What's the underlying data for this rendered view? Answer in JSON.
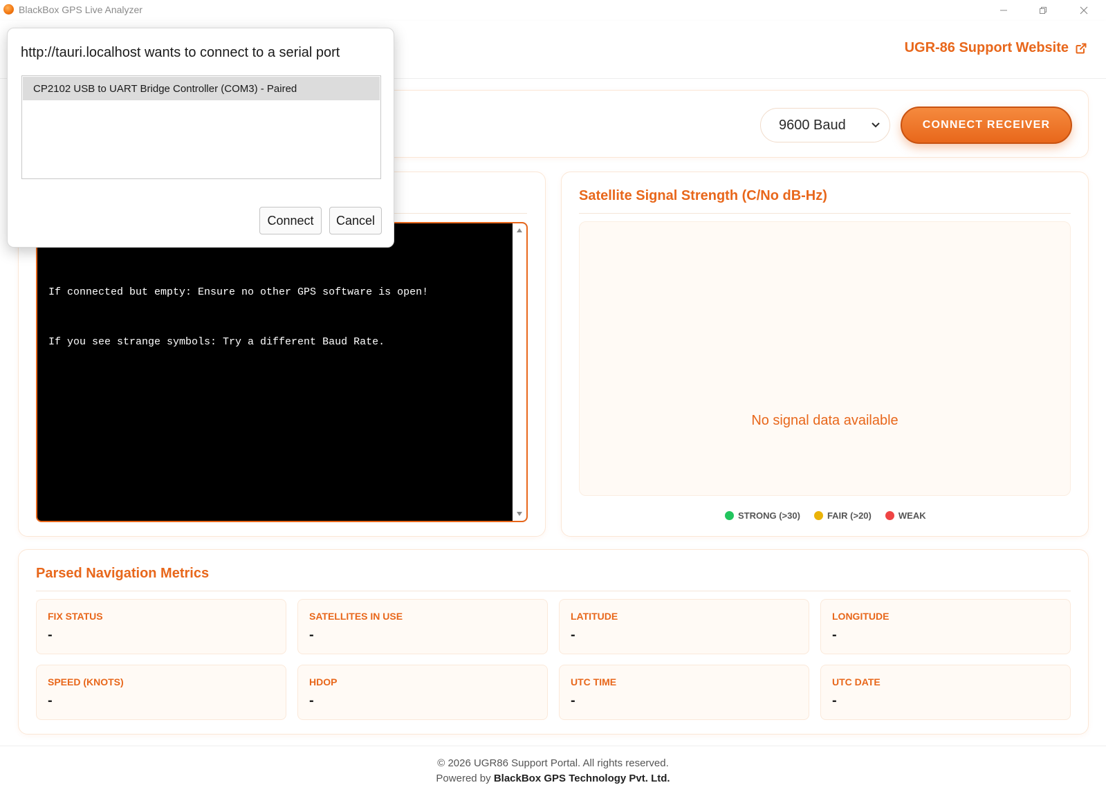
{
  "window": {
    "title": "BlackBox GPS Live Analyzer",
    "controls": [
      "minimize",
      "restore",
      "close"
    ]
  },
  "header": {
    "support_link": "UGR-86 Support Website",
    "support_icon": "external-link-icon"
  },
  "controls": {
    "baud_value": "9600 Baud",
    "connect_button": "CONNECT RECEIVER"
  },
  "terminal": {
    "lines": [
      "If connected but empty: Ensure no other GPS software is open!",
      "If you see strange symbols: Try a different Baud Rate."
    ]
  },
  "signal": {
    "title": "Satellite Signal Strength (C/No dB-Hz)",
    "empty_message": "No signal data available",
    "legend": [
      {
        "label": "STRONG (>30)",
        "color": "#22c55e"
      },
      {
        "label": "FAIR (>20)",
        "color": "#eab308"
      },
      {
        "label": "WEAK",
        "color": "#ef4444"
      }
    ]
  },
  "metrics": {
    "title": "Parsed Navigation Metrics",
    "items": [
      {
        "label": "FIX STATUS",
        "value": "-"
      },
      {
        "label": "SATELLITES IN USE",
        "value": "-"
      },
      {
        "label": "LATITUDE",
        "value": "-"
      },
      {
        "label": "LONGITUDE",
        "value": "-"
      },
      {
        "label": "SPEED (KNOTS)",
        "value": "-"
      },
      {
        "label": "HDOP",
        "value": "-"
      },
      {
        "label": "UTC TIME",
        "value": "-"
      },
      {
        "label": "UTC DATE",
        "value": "-"
      }
    ]
  },
  "footer": {
    "copyright": "© 2026 UGR86 Support Portal. All rights reserved.",
    "powered_prefix": "Powered by ",
    "powered_company": "BlackBox GPS Technology Pvt. Ltd."
  },
  "dialog": {
    "title": "http://tauri.localhost wants to connect to a serial port",
    "ports": [
      "CP2102 USB to UART Bridge Controller (COM3) - Paired"
    ],
    "connect_label": "Connect",
    "cancel_label": "Cancel"
  },
  "colors": {
    "accent": "#e8671b",
    "terminal_bg": "#000000",
    "panel_tint": "#fffaf5"
  }
}
